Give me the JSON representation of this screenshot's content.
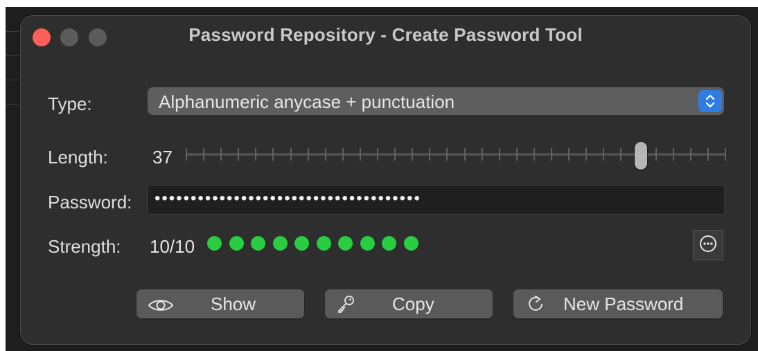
{
  "window": {
    "title": "Password Repository - Create Password Tool"
  },
  "traffic_lights": {
    "close_color": "#ff5f57",
    "minimize_color": "#5b5b5b",
    "zoom_color": "#5b5b5b"
  },
  "type": {
    "label": "Type:",
    "selected": "Alphanumeric anycase + punctuation"
  },
  "length": {
    "label": "Length:",
    "value": "37",
    "slider_fraction": 0.85
  },
  "password": {
    "label": "Password:",
    "masked_value": "•••••••••••••••••••••••••••••••••••••"
  },
  "strength": {
    "label": "Strength:",
    "value": "10/10",
    "dot_count": 10,
    "dot_color": "#28cd41"
  },
  "buttons": {
    "show": "Show",
    "copy": "Copy",
    "new_password": "New Password"
  },
  "icons": {
    "more": "ellipsis-circle-icon",
    "show": "eye-icon",
    "copy": "key-icon",
    "new_password": "refresh-icon",
    "select": "up-down-chevron-icon"
  }
}
